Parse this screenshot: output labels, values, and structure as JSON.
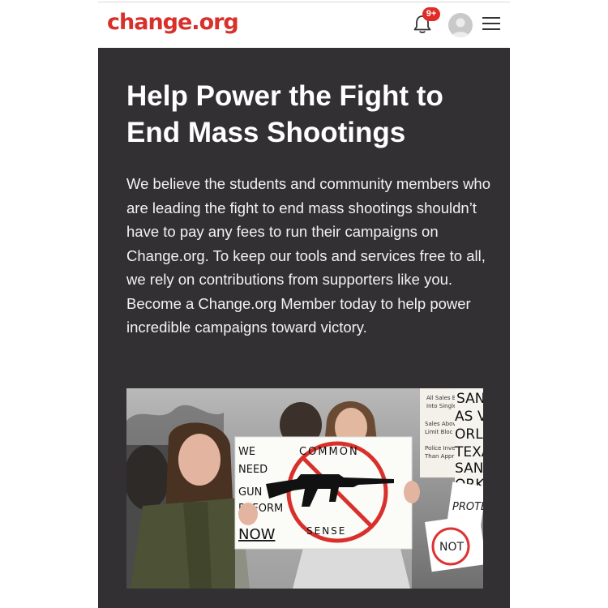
{
  "header": {
    "logo": "change.org",
    "notifications_badge": "9+",
    "icons": [
      "bell-icon",
      "avatar-icon",
      "hamburger-menu-icon"
    ],
    "brand_color": "#d8302b"
  },
  "main": {
    "title": "Help Power the Fight to End Mass Shootings",
    "body": "We believe the students and community members who are leading the fight to end mass shootings shouldn’t have to pay any fees to run their campaigns on Change.org. To keep our tools and services free to all, we rely on contributions from supporters like you. Become a Change.org Member today to help power incredible campaigns toward victory.",
    "panel_color": "#333034"
  },
  "photo": {
    "sign_left": [
      "WE",
      "NEED",
      "GUN",
      "REFORM",
      "NOW"
    ],
    "sign_center_top": "COMMON",
    "sign_center_bottom": "SENSE",
    "bg_sign_small": [
      "All Sales E",
      "Into Single",
      "Sales Abov",
      "Limit Bloc",
      "Police Inve",
      "Than Appr"
    ],
    "bg_sign_big": [
      "SAN",
      "AS V",
      "ORLAN",
      "TEXA",
      "SAN",
      "ORK"
    ],
    "bg_sign_protect": "PROTEC",
    "bg_sign_not": "NOT"
  }
}
